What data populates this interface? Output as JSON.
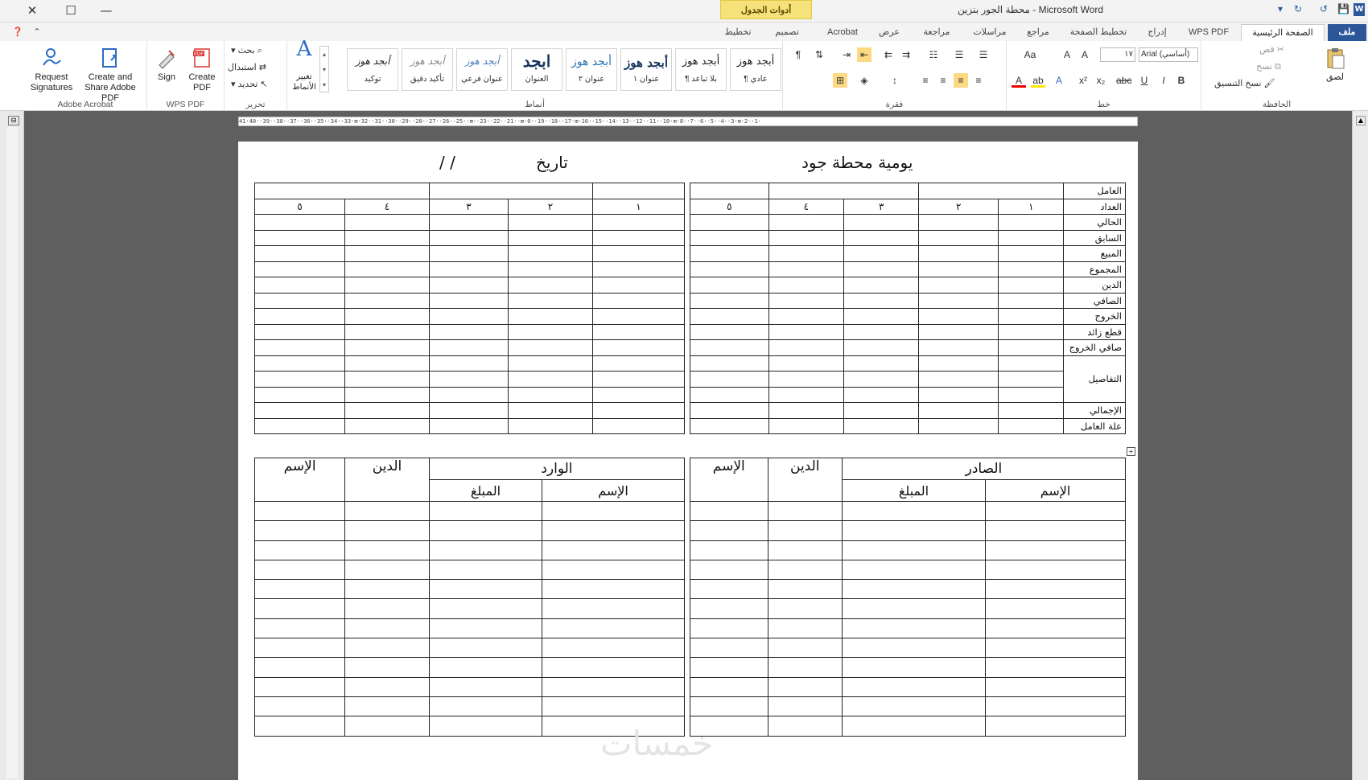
{
  "app": {
    "title": "محطة الجور بنزين - Microsoft Word",
    "context_tab": "أدوات الجدول"
  },
  "window": {
    "close": "✕",
    "maximize": "☐",
    "minimize": "—"
  },
  "tabs": [
    {
      "label": "ملف"
    },
    {
      "label": "الصفحة الرئيسية"
    },
    {
      "label": "WPS PDF"
    },
    {
      "label": "إدراج"
    },
    {
      "label": "تخطيط الصفحة"
    },
    {
      "label": "مراجع"
    },
    {
      "label": "مراسلات"
    },
    {
      "label": "مراجعة"
    },
    {
      "label": "عرض"
    },
    {
      "label": "Acrobat"
    },
    {
      "label": "تصميم"
    },
    {
      "label": "تخطيط"
    }
  ],
  "ribbon": {
    "acrobat": {
      "label": "Adobe Acrobat",
      "request": "Request Signatures",
      "create_share": "Create and Share Adobe PDF"
    },
    "wps": {
      "label": "WPS PDF",
      "sign": "Sign",
      "create": "Create PDF"
    },
    "editing": {
      "label": "تحرير",
      "find": "بحث",
      "replace": "استبدال",
      "select": "تحديد"
    },
    "styles": {
      "label": "أنماط",
      "change": "تغيير الأنماط",
      "items": [
        {
          "sample": "أبجد هوز",
          "name": "¶ عادي"
        },
        {
          "sample": "أبجد هوز",
          "name": "¶ بلا تباعد"
        },
        {
          "sample": "أبجد هوز",
          "name": "عنوان ١"
        },
        {
          "sample": "أبجد هوز",
          "name": "عنوان ٢"
        },
        {
          "sample": "ابجد",
          "name": "العنوان"
        },
        {
          "sample": "أبجد هوز",
          "name": "عنوان فرعي"
        },
        {
          "sample": "أبجد هوز",
          "name": "تأكيد دقيق"
        },
        {
          "sample": "أبجد هوز",
          "name": "توكيد"
        }
      ]
    },
    "paragraph": {
      "label": "فقرة"
    },
    "font": {
      "label": "خط",
      "name": "Arial (أساسي)",
      "size": "١٧"
    },
    "clipboard": {
      "label": "الحافظة",
      "paste": "لصق",
      "cut": "قص",
      "copy": "نسخ",
      "format_painter": "نسخ التنسيق"
    }
  },
  "ruler_text": "41·40··39··38··37··36··35··34··33·⊞·32··31··30··29··28··27··26··25··⊞··23··22··21··⊞·0··19··18··17·⊞·16··15··14··13··12··11··10·⊞·8··7··6··5··4··3·⊞·2··1·",
  "document": {
    "title": "يومية محطة جود",
    "date_label": "تاريخ",
    "date_slashes": "/        /",
    "row_labels": [
      "العامل",
      "العداد",
      "الحالي",
      "السابق",
      "المبيع",
      "المجموع",
      "الدين",
      "الصافي",
      "الخروج",
      "قطع زائد",
      "صافي الخروج",
      "التفاصيل",
      "الإجمالي",
      "علة العامل"
    ],
    "numbers": [
      "١",
      "٢",
      "٣",
      "٤",
      "٥"
    ],
    "bottom": {
      "outgoing": "الصادر",
      "incoming": "الوارد",
      "debt": "الدين",
      "name": "الإسم",
      "amount": "المبلغ"
    },
    "watermark": "خمسات"
  }
}
